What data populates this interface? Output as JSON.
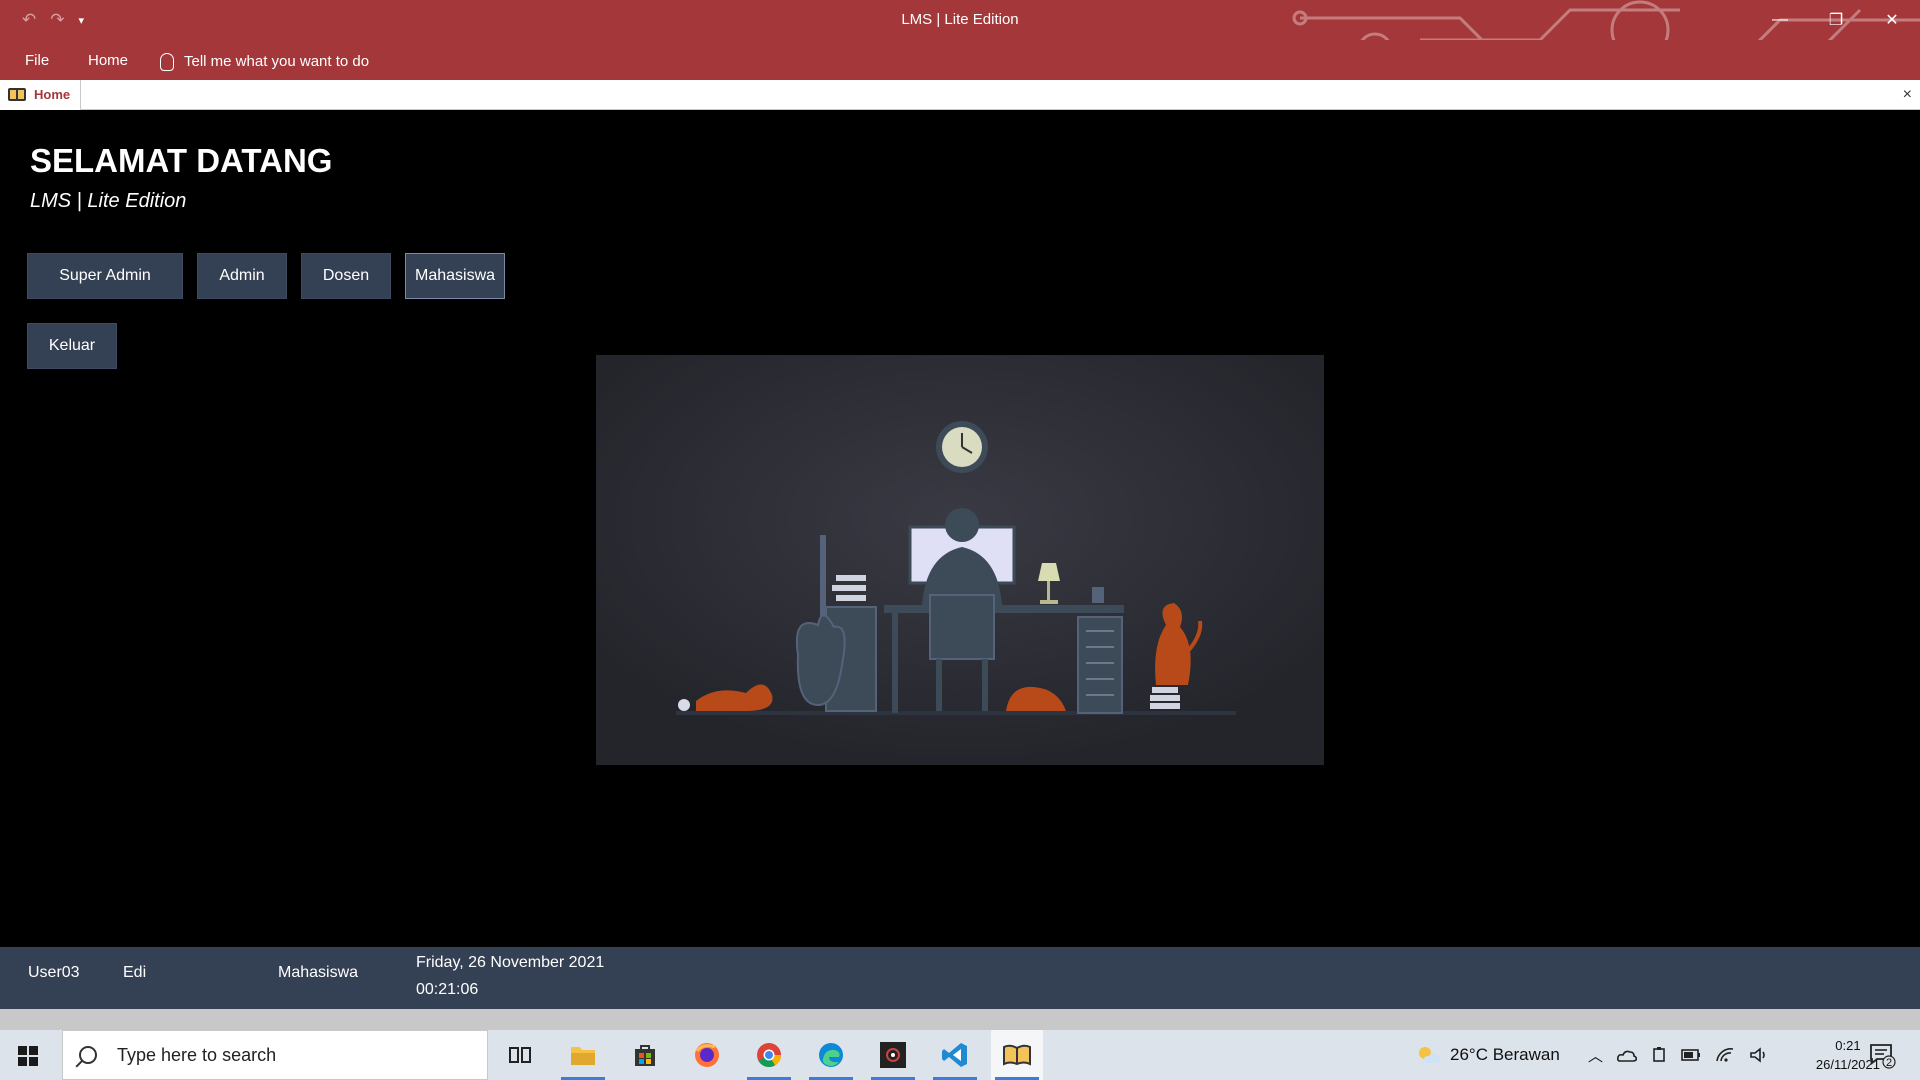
{
  "window": {
    "title": "LMS | Lite Edition",
    "qat": {
      "undo": "↶",
      "redo": "↷",
      "customize": "▾"
    },
    "controls": {
      "minimize": "—",
      "restore": "❐",
      "close": "✕"
    }
  },
  "menu": {
    "file": "File",
    "home": "Home",
    "tell_me": "Tell me what you want to do"
  },
  "doc_tab": {
    "label": "Home",
    "close": "×"
  },
  "form": {
    "welcome": "SELAMAT DATANG",
    "subtitle": "LMS | Lite Edition",
    "buttons": {
      "super_admin": "Super Admin",
      "admin": "Admin",
      "dosen": "Dosen",
      "mahasiswa": "Mahasiswa",
      "keluar": "Keluar"
    }
  },
  "status": {
    "user_id": "User03",
    "user_name": "Edi",
    "role": "Mahasiswa",
    "date": "Friday, 26 November 2021",
    "time": "00:21:06"
  },
  "taskbar": {
    "search_placeholder": "Type here to search",
    "icons": [
      "windows-start-icon",
      "search-icon",
      "task-view-icon",
      "file-explorer-icon",
      "microsoft-store-icon",
      "firefox-icon",
      "chrome-icon",
      "edge-icon",
      "obs-icon",
      "vscode-icon",
      "access-lms-icon"
    ],
    "weather": "26°C  Berawan",
    "clock_time": "0:21",
    "clock_date": "26/11/2021",
    "notification_count": "2"
  },
  "colors": {
    "titlebar": "#a4373a",
    "button_bg": "#344053",
    "statusbar_bg": "#344053",
    "form_bg": "#000000"
  }
}
